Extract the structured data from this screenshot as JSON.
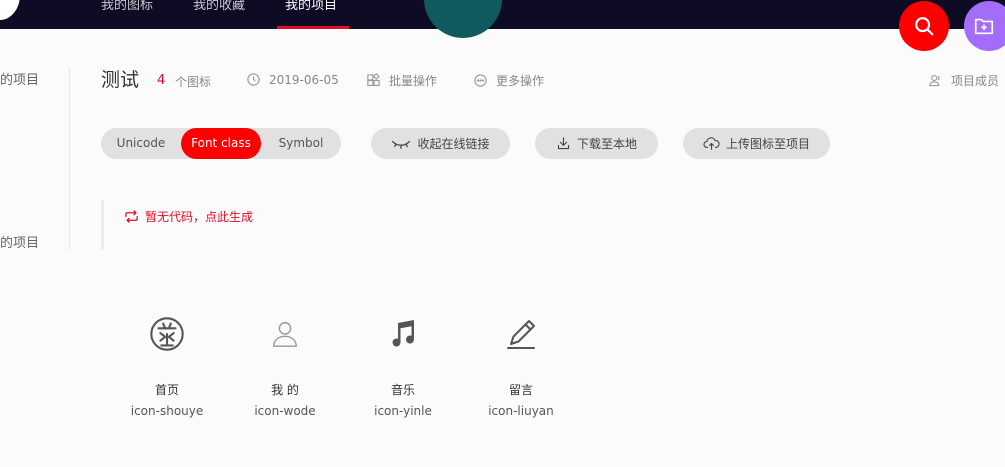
{
  "nav": {
    "items": [
      {
        "label": "我的图标"
      },
      {
        "label": "我的收藏"
      },
      {
        "label": "我的项目"
      }
    ]
  },
  "sidebar": {
    "item_a": "的项目",
    "item_b": "的项目"
  },
  "project": {
    "title": "测试",
    "icon_count": "4",
    "icon_count_unit": "个图标",
    "date": "2019-06-05",
    "batch_label": "批量操作",
    "more_label": "更多操作",
    "members_label": "项目成员"
  },
  "toolbar": {
    "tabs": [
      {
        "label": "Unicode"
      },
      {
        "label": "Font class"
      },
      {
        "label": "Symbol"
      }
    ],
    "active_tab": "Font class",
    "collapse_label": "收起在线链接",
    "download_label": "下载至本地",
    "upload_label": "上传图标至项目"
  },
  "code": {
    "message": "暂无代码，点此生成"
  },
  "icons": [
    {
      "name": "首页",
      "class": "icon-shouye",
      "icon": "home-emblem-icon"
    },
    {
      "name": "我 的",
      "class": "icon-wode",
      "icon": "user-icon"
    },
    {
      "name": "音乐",
      "class": "icon-yinle",
      "icon": "music-note-icon"
    },
    {
      "name": "留言",
      "class": "icon-liuyan",
      "icon": "pen-icon"
    }
  ],
  "colors": {
    "accent": "#ff0000",
    "nav_bg": "#0d0c24",
    "fab_purple": "#a36dfa",
    "pill_bg": "#e1e1e1"
  }
}
